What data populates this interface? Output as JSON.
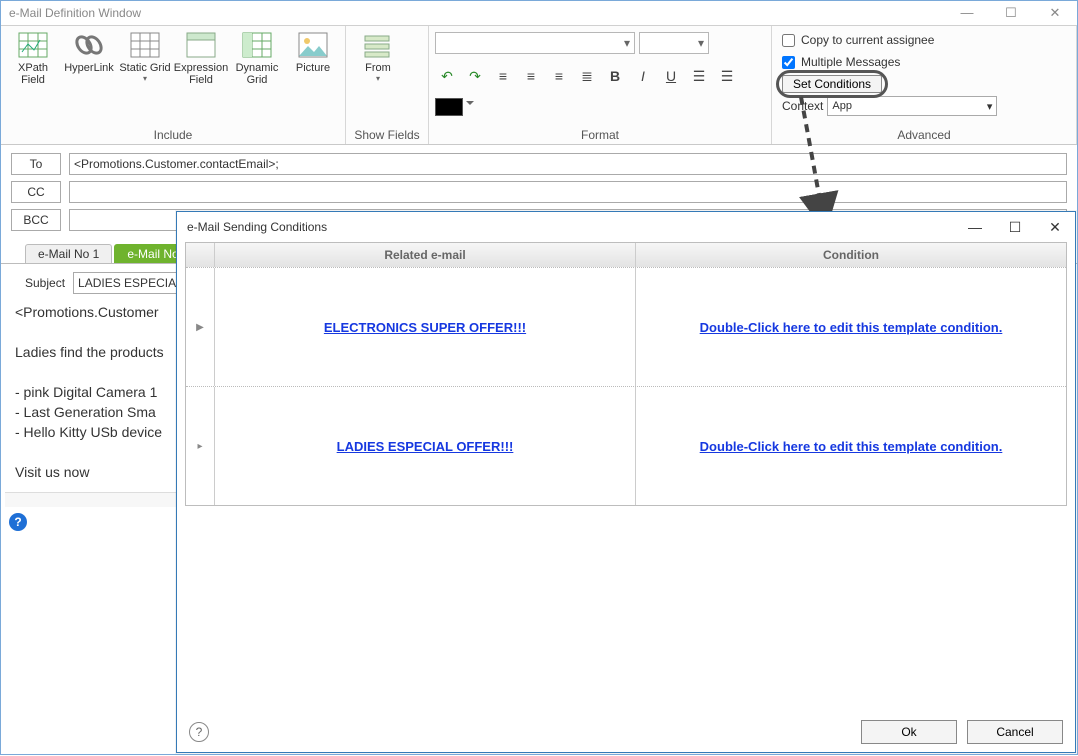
{
  "window": {
    "title": "e-Mail Definition Window"
  },
  "ribbon": {
    "include": {
      "label": "Include",
      "tools": {
        "xpath": "XPath Field",
        "hyperlink": "HyperLink",
        "staticgrid": "Static Grid",
        "exprfield": "Expression Field",
        "dyngrid": "Dynamic Grid",
        "picture": "Picture"
      }
    },
    "showfields": {
      "label": "Show Fields",
      "from": "From"
    },
    "format": {
      "label": "Format"
    },
    "advanced": {
      "label": "Advanced",
      "copy_assignee": "Copy to current assignee",
      "multiple_msgs": "Multiple Messages",
      "set_conditions": "Set Conditions",
      "context_label": "Context",
      "context_value": "App"
    }
  },
  "address": {
    "to_label": "To",
    "to_value": "<Promotions.Customer.contactEmail>;",
    "cc_label": "CC",
    "cc_value": "",
    "bcc_label": "BCC",
    "bcc_value": ""
  },
  "tabs": {
    "t1": "e-Mail No   1",
    "t2": "e-Mail No"
  },
  "subject": {
    "label": "Subject",
    "value": "LADIES ESPECIAL"
  },
  "body_text": "<Promotions.Customer\n\nLadies find the products\n\n- pink Digital Camera 1\n- Last Generation Sma\n- Hello Kitty USb device\n\nVisit us now",
  "dialog": {
    "title": "e-Mail Sending Conditions",
    "headers": {
      "related": "Related e-mail",
      "condition": "Condition"
    },
    "rows": [
      {
        "related": "ELECTRONICS SUPER OFFER!!!",
        "condition": "Double-Click here to edit this template condition."
      },
      {
        "related": "LADIES ESPECIAL OFFER!!!",
        "condition": "Double-Click here to edit this template condition."
      }
    ],
    "ok": "Ok",
    "cancel": "Cancel"
  }
}
